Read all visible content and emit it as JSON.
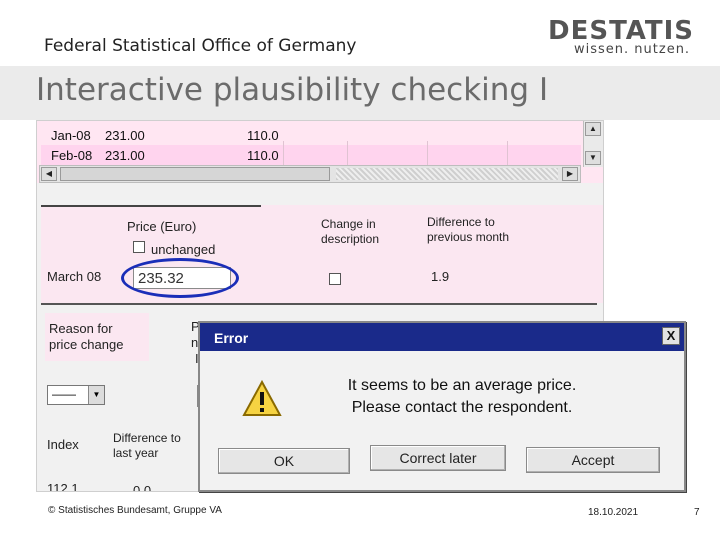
{
  "header": {
    "org": "Federal Statistical Office of Germany",
    "logo_word": "DESTATIS",
    "logo_tagline": "wissen. nutzen.",
    "title": "Interactive plausibility checking I"
  },
  "table": {
    "rows": [
      {
        "month": "Jan-08",
        "price": "231.00",
        "index": "110.0"
      },
      {
        "month": "Feb-08",
        "price": "231.00",
        "index": "110.0"
      }
    ]
  },
  "form": {
    "price_label": "Price (Euro)",
    "unchanged_label": "unchanged",
    "change_desc_label_1": "Change in",
    "change_desc_label_2": "description",
    "diff_prev_label_1": "Difference to",
    "diff_prev_label_2": "previous month",
    "month": "March 08",
    "price_value": "235.32",
    "diff_prev_value": "1.9",
    "reason_label_1": "Reason for",
    "reason_label_2": "price change",
    "reason_combo_value": "——",
    "hidden_label_p": "P",
    "hidden_label_n": "n",
    "hidden_label_i": "I",
    "index_label": "Index",
    "diff_year_label_1": "Difference to",
    "diff_year_label_2": "last year",
    "index_value": "112.1",
    "diff_year_value": "0.0"
  },
  "dialog": {
    "title": "Error",
    "close_glyph": "X",
    "message_1": "It seems to be an average price.",
    "message_2": "Please contact the respondent.",
    "ok_label": "OK",
    "later_label": "Correct later",
    "accept_label": "Accept"
  },
  "footer": {
    "copyright": "© Statistisches Bundesamt, Gruppe VA",
    "date": "18.10.2021",
    "page": "7"
  },
  "colors": {
    "dialog_titlebar": "#1a2a8a",
    "highlight_ellipse": "#1a2eb8",
    "row_pink": "#ffd4ee"
  }
}
